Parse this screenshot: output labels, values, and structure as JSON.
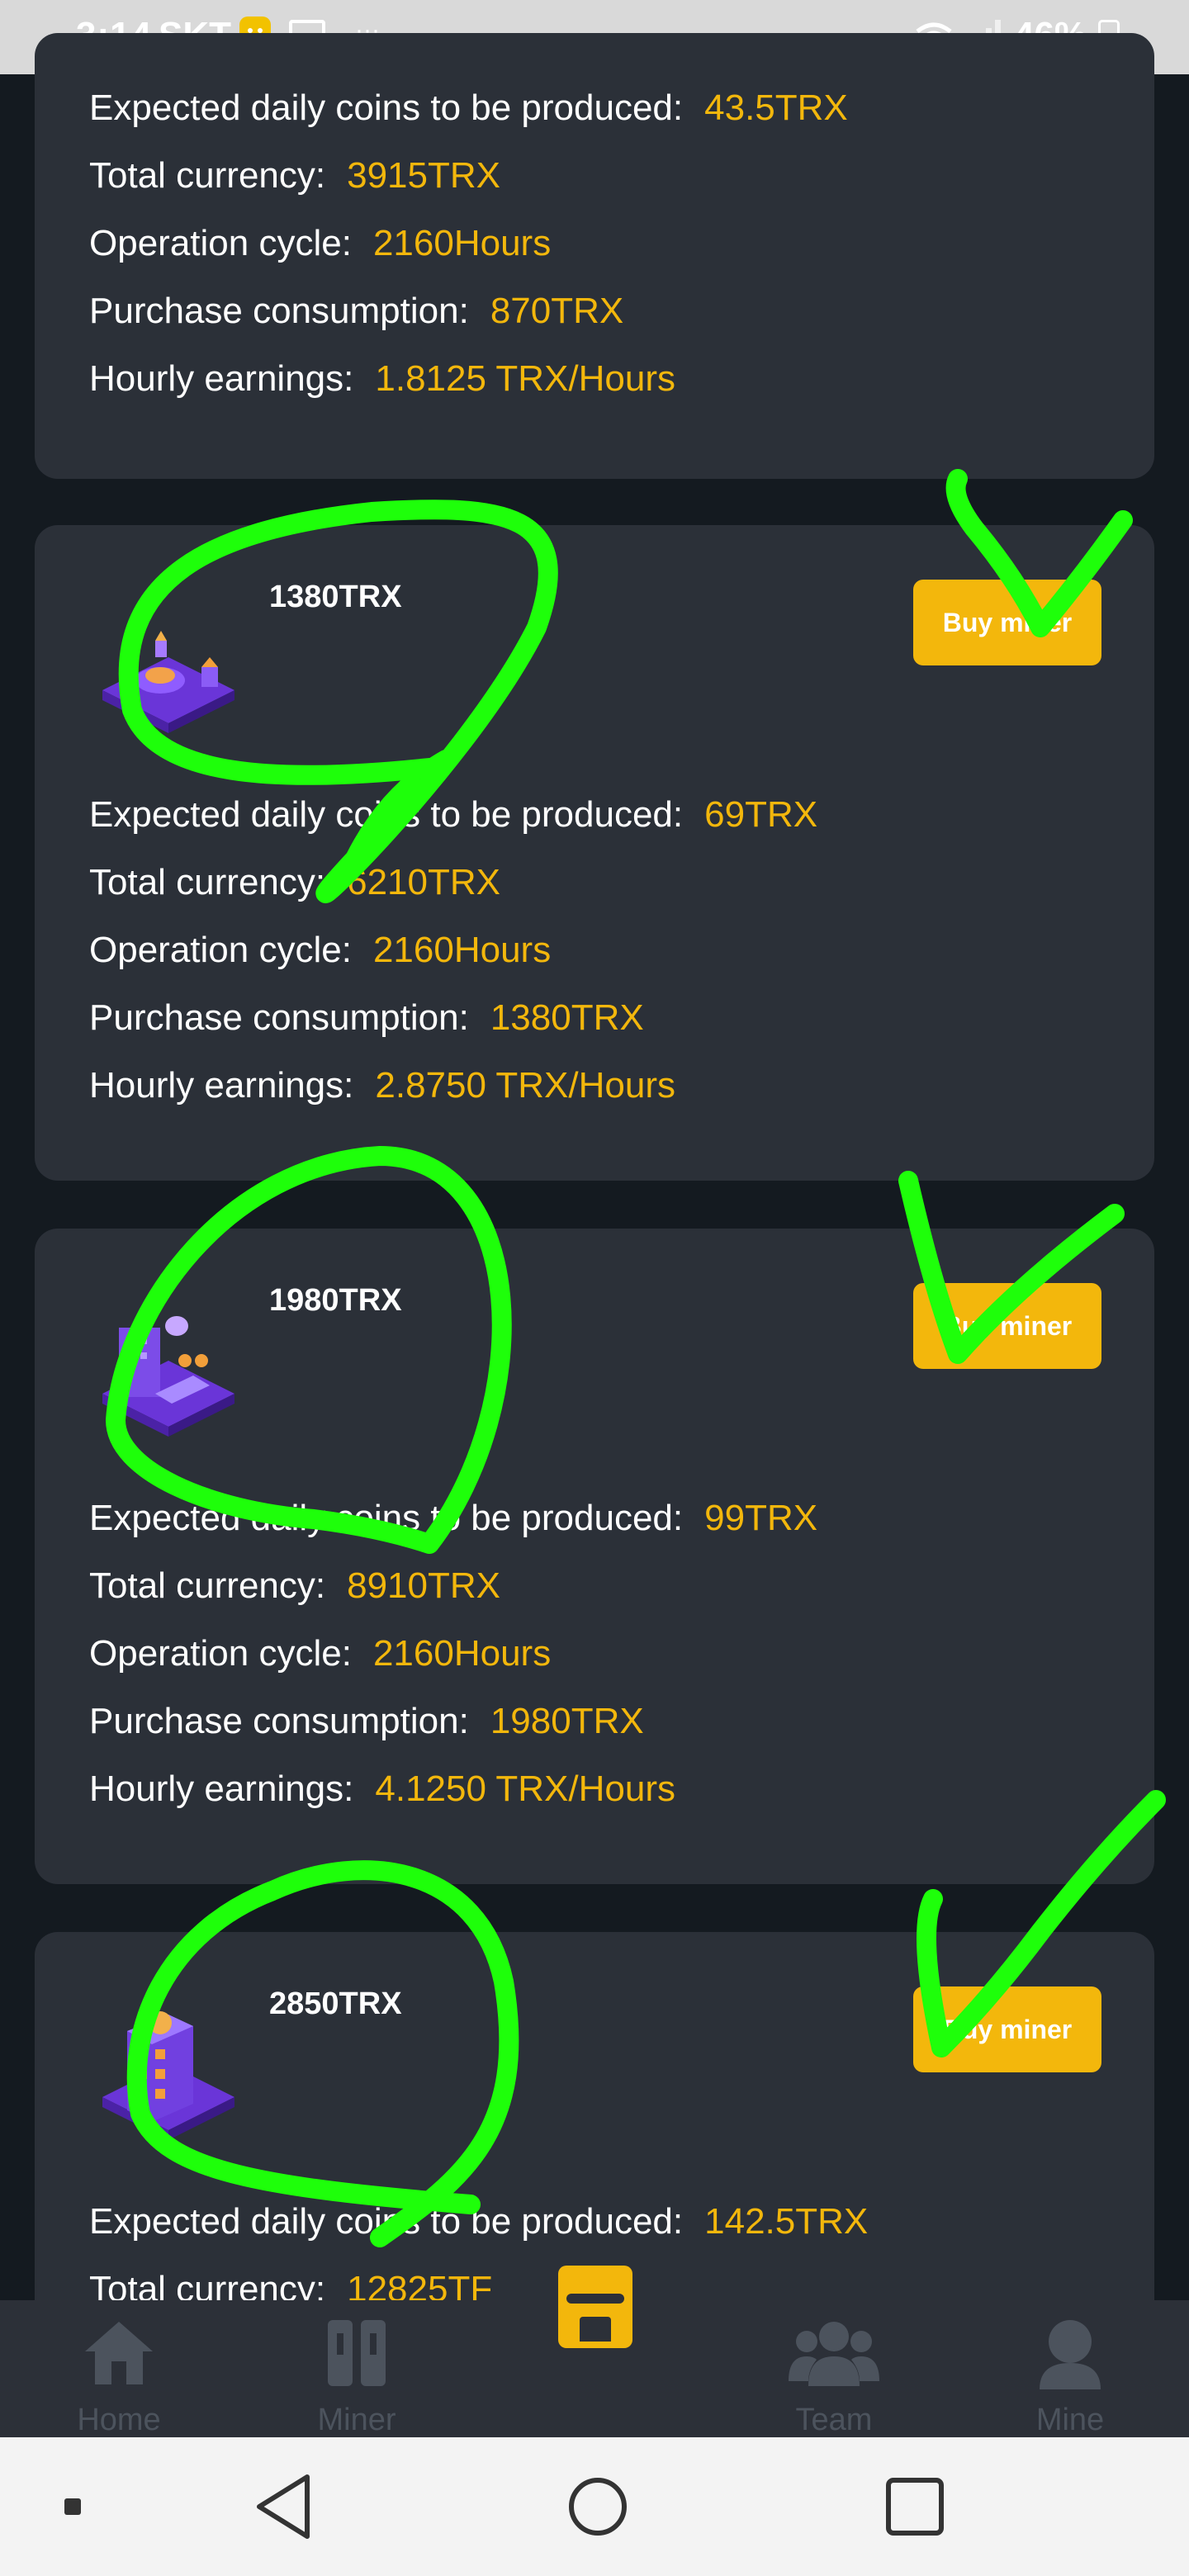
{
  "status_bar": {
    "time": "3:14",
    "carrier": "SKT",
    "battery": "46%",
    "dots": "···"
  },
  "labels": {
    "daily": "Expected daily coins to be produced:",
    "total": "Total currency:",
    "cycle": "Operation cycle:",
    "purchase": "Purchase consumption:",
    "hourly": "Hourly earnings:"
  },
  "cards": [
    {
      "daily": "43.5TRX",
      "total": "3915TRX",
      "cycle": "2160Hours",
      "purchase": "870TRX",
      "hourly": "1.8125 TRX/Hours"
    },
    {
      "price": "1380TRX",
      "buy_label": "Buy miner",
      "daily": "69TRX",
      "total": "6210TRX",
      "cycle": "2160Hours",
      "purchase": "1380TRX",
      "hourly": "2.8750 TRX/Hours"
    },
    {
      "price": "1980TRX",
      "buy_label": "Buy miner",
      "daily": "99TRX",
      "total": "8910TRX",
      "cycle": "2160Hours",
      "purchase": "1980TRX",
      "hourly": "4.1250 TRX/Hours"
    },
    {
      "price": "2850TRX",
      "buy_label": "Buy miner",
      "daily": "142.5TRX",
      "total": "12825TF"
    }
  ],
  "nav": {
    "home": "Home",
    "miner": "Miner",
    "team": "Team",
    "mine": "Mine"
  },
  "colors": {
    "accent": "#f3b70c",
    "card": "#2b3038",
    "background": "#141a20",
    "annotation": "#1eff0a"
  }
}
